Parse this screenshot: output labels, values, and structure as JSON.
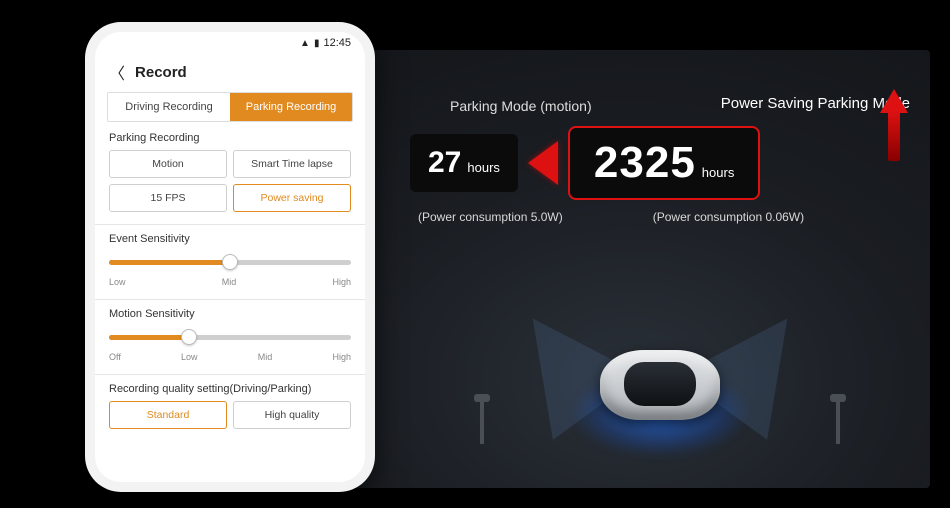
{
  "status": {
    "signal": "▲",
    "battery": "▮",
    "time": "12:45"
  },
  "header": {
    "title": "Record"
  },
  "tabs": {
    "driving": "Driving Recording",
    "parking": "Parking Recording"
  },
  "parkingRecording": {
    "label": "Parking Recording",
    "motion": "Motion",
    "timelapse": "Smart Time lapse",
    "fps": "15 FPS",
    "powersaving": "Power saving"
  },
  "eventSensitivity": {
    "label": "Event Sensitivity",
    "low": "Low",
    "mid": "Mid",
    "high": "High"
  },
  "motionSensitivity": {
    "label": "Motion Sensitivity",
    "off": "Off",
    "low": "Low",
    "mid": "Mid",
    "high": "High"
  },
  "quality": {
    "label": "Recording quality setting(Driving/Parking)",
    "standard": "Standard",
    "high": "High quality"
  },
  "info": {
    "pmLabel": "Parking Mode (motion)",
    "psLabel": "Power Saving Parking Mode",
    "pmHours": "27",
    "psHours": "2325",
    "unit": "hours",
    "pmPower": "(Power consumption  5.0W)",
    "psPower": "(Power consumption  0.06W)"
  }
}
